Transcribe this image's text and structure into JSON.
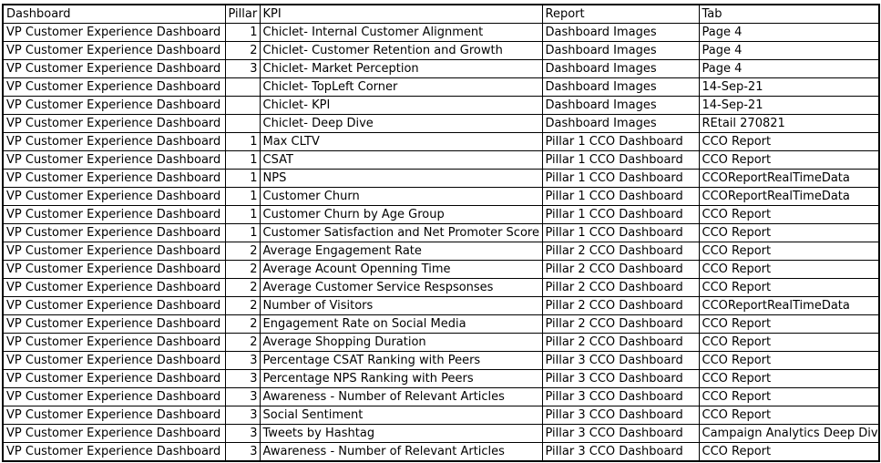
{
  "columns": {
    "dashboard": "Dashboard",
    "pillar": "Pillar",
    "kpi": "KPI",
    "report": "Report",
    "tab": "Tab"
  },
  "rows": [
    {
      "dashboard": "VP Customer Experience Dashboard",
      "pillar": "1",
      "kpi": "Chiclet- Internal Customer Alignment",
      "report": "Dashboard Images",
      "tab": "Page 4"
    },
    {
      "dashboard": "VP Customer Experience Dashboard",
      "pillar": "2",
      "kpi": "Chiclet- Customer Retention and Growth",
      "report": "Dashboard Images",
      "tab": "Page 4"
    },
    {
      "dashboard": "VP Customer Experience Dashboard",
      "pillar": "3",
      "kpi": "Chiclet- Market Perception",
      "report": "Dashboard Images",
      "tab": "Page 4"
    },
    {
      "dashboard": "VP Customer Experience Dashboard",
      "pillar": "",
      "kpi": "Chiclet- TopLeft Corner",
      "report": "Dashboard Images",
      "tab": "14-Sep-21"
    },
    {
      "dashboard": "VP Customer Experience Dashboard",
      "pillar": "",
      "kpi": "Chiclet- KPI",
      "report": "Dashboard Images",
      "tab": "14-Sep-21"
    },
    {
      "dashboard": "VP Customer Experience Dashboard",
      "pillar": "",
      "kpi": "Chiclet- Deep Dive",
      "report": "Dashboard Images",
      "tab": "REtail 270821"
    },
    {
      "dashboard": "VP Customer Experience Dashboard",
      "pillar": "1",
      "kpi": "Max CLTV",
      "report": "Pillar 1 CCO Dashboard",
      "tab": "CCO Report"
    },
    {
      "dashboard": "VP Customer Experience Dashboard",
      "pillar": "1",
      "kpi": "CSAT",
      "report": "Pillar 1 CCO Dashboard",
      "tab": "CCO Report"
    },
    {
      "dashboard": "VP Customer Experience Dashboard",
      "pillar": "1",
      "kpi": "NPS",
      "report": "Pillar 1 CCO Dashboard",
      "tab": "CCOReportRealTimeData"
    },
    {
      "dashboard": "VP Customer Experience Dashboard",
      "pillar": "1",
      "kpi": "Customer Churn",
      "report": "Pillar 1 CCO Dashboard",
      "tab": "CCOReportRealTimeData"
    },
    {
      "dashboard": "VP Customer Experience Dashboard",
      "pillar": "1",
      "kpi": "Customer Churn by Age Group",
      "report": "Pillar 1 CCO Dashboard",
      "tab": "CCO Report"
    },
    {
      "dashboard": "VP Customer Experience Dashboard",
      "pillar": "1",
      "kpi": "Customer Satisfaction and Net Promoter Score",
      "report": "Pillar 1 CCO Dashboard",
      "tab": "CCO Report"
    },
    {
      "dashboard": "VP Customer Experience Dashboard",
      "pillar": "2",
      "kpi": "Average Engagement Rate",
      "report": "Pillar 2 CCO Dashboard",
      "tab": "CCO Report"
    },
    {
      "dashboard": "VP Customer Experience Dashboard",
      "pillar": "2",
      "kpi": "Average Acount Openning Time",
      "report": "Pillar 2 CCO Dashboard",
      "tab": "CCO Report"
    },
    {
      "dashboard": "VP Customer Experience Dashboard",
      "pillar": "2",
      "kpi": "Average Customer Service Respsonses",
      "report": "Pillar 2 CCO Dashboard",
      "tab": "CCO Report"
    },
    {
      "dashboard": "VP Customer Experience Dashboard",
      "pillar": "2",
      "kpi": "Number of Visitors",
      "report": "Pillar 2 CCO Dashboard",
      "tab": "CCOReportRealTimeData"
    },
    {
      "dashboard": "VP Customer Experience Dashboard",
      "pillar": "2",
      "kpi": "Engagement Rate on Social Media",
      "report": "Pillar 2 CCO Dashboard",
      "tab": "CCO Report"
    },
    {
      "dashboard": "VP Customer Experience Dashboard",
      "pillar": "2",
      "kpi": "Average Shopping Duration",
      "report": "Pillar 2 CCO Dashboard",
      "tab": "CCO Report"
    },
    {
      "dashboard": "VP Customer Experience Dashboard",
      "pillar": "3",
      "kpi": "Percentage CSAT Ranking with Peers",
      "report": "Pillar 3 CCO Dashboard",
      "tab": "CCO Report"
    },
    {
      "dashboard": "VP Customer Experience Dashboard",
      "pillar": "3",
      "kpi": "Percentage NPS Ranking with Peers",
      "report": "Pillar 3 CCO Dashboard",
      "tab": "CCO Report"
    },
    {
      "dashboard": "VP Customer Experience Dashboard",
      "pillar": "3",
      "kpi": "Awareness - Number of Relevant Articles",
      "report": "Pillar 3 CCO Dashboard",
      "tab": "CCO Report"
    },
    {
      "dashboard": "VP Customer Experience Dashboard",
      "pillar": "3",
      "kpi": "Social Sentiment",
      "report": "Pillar 3 CCO Dashboard",
      "tab": "CCO Report"
    },
    {
      "dashboard": "VP Customer Experience Dashboard",
      "pillar": "3",
      "kpi": "Tweets by Hashtag",
      "report": "Pillar 3 CCO Dashboard",
      "tab": "Campaign Analytics Deep Dive"
    },
    {
      "dashboard": "VP Customer Experience Dashboard",
      "pillar": "3",
      "kpi": "Awareness - Number of Relevant Articles",
      "report": "Pillar 3 CCO Dashboard",
      "tab": "CCO Report"
    }
  ]
}
